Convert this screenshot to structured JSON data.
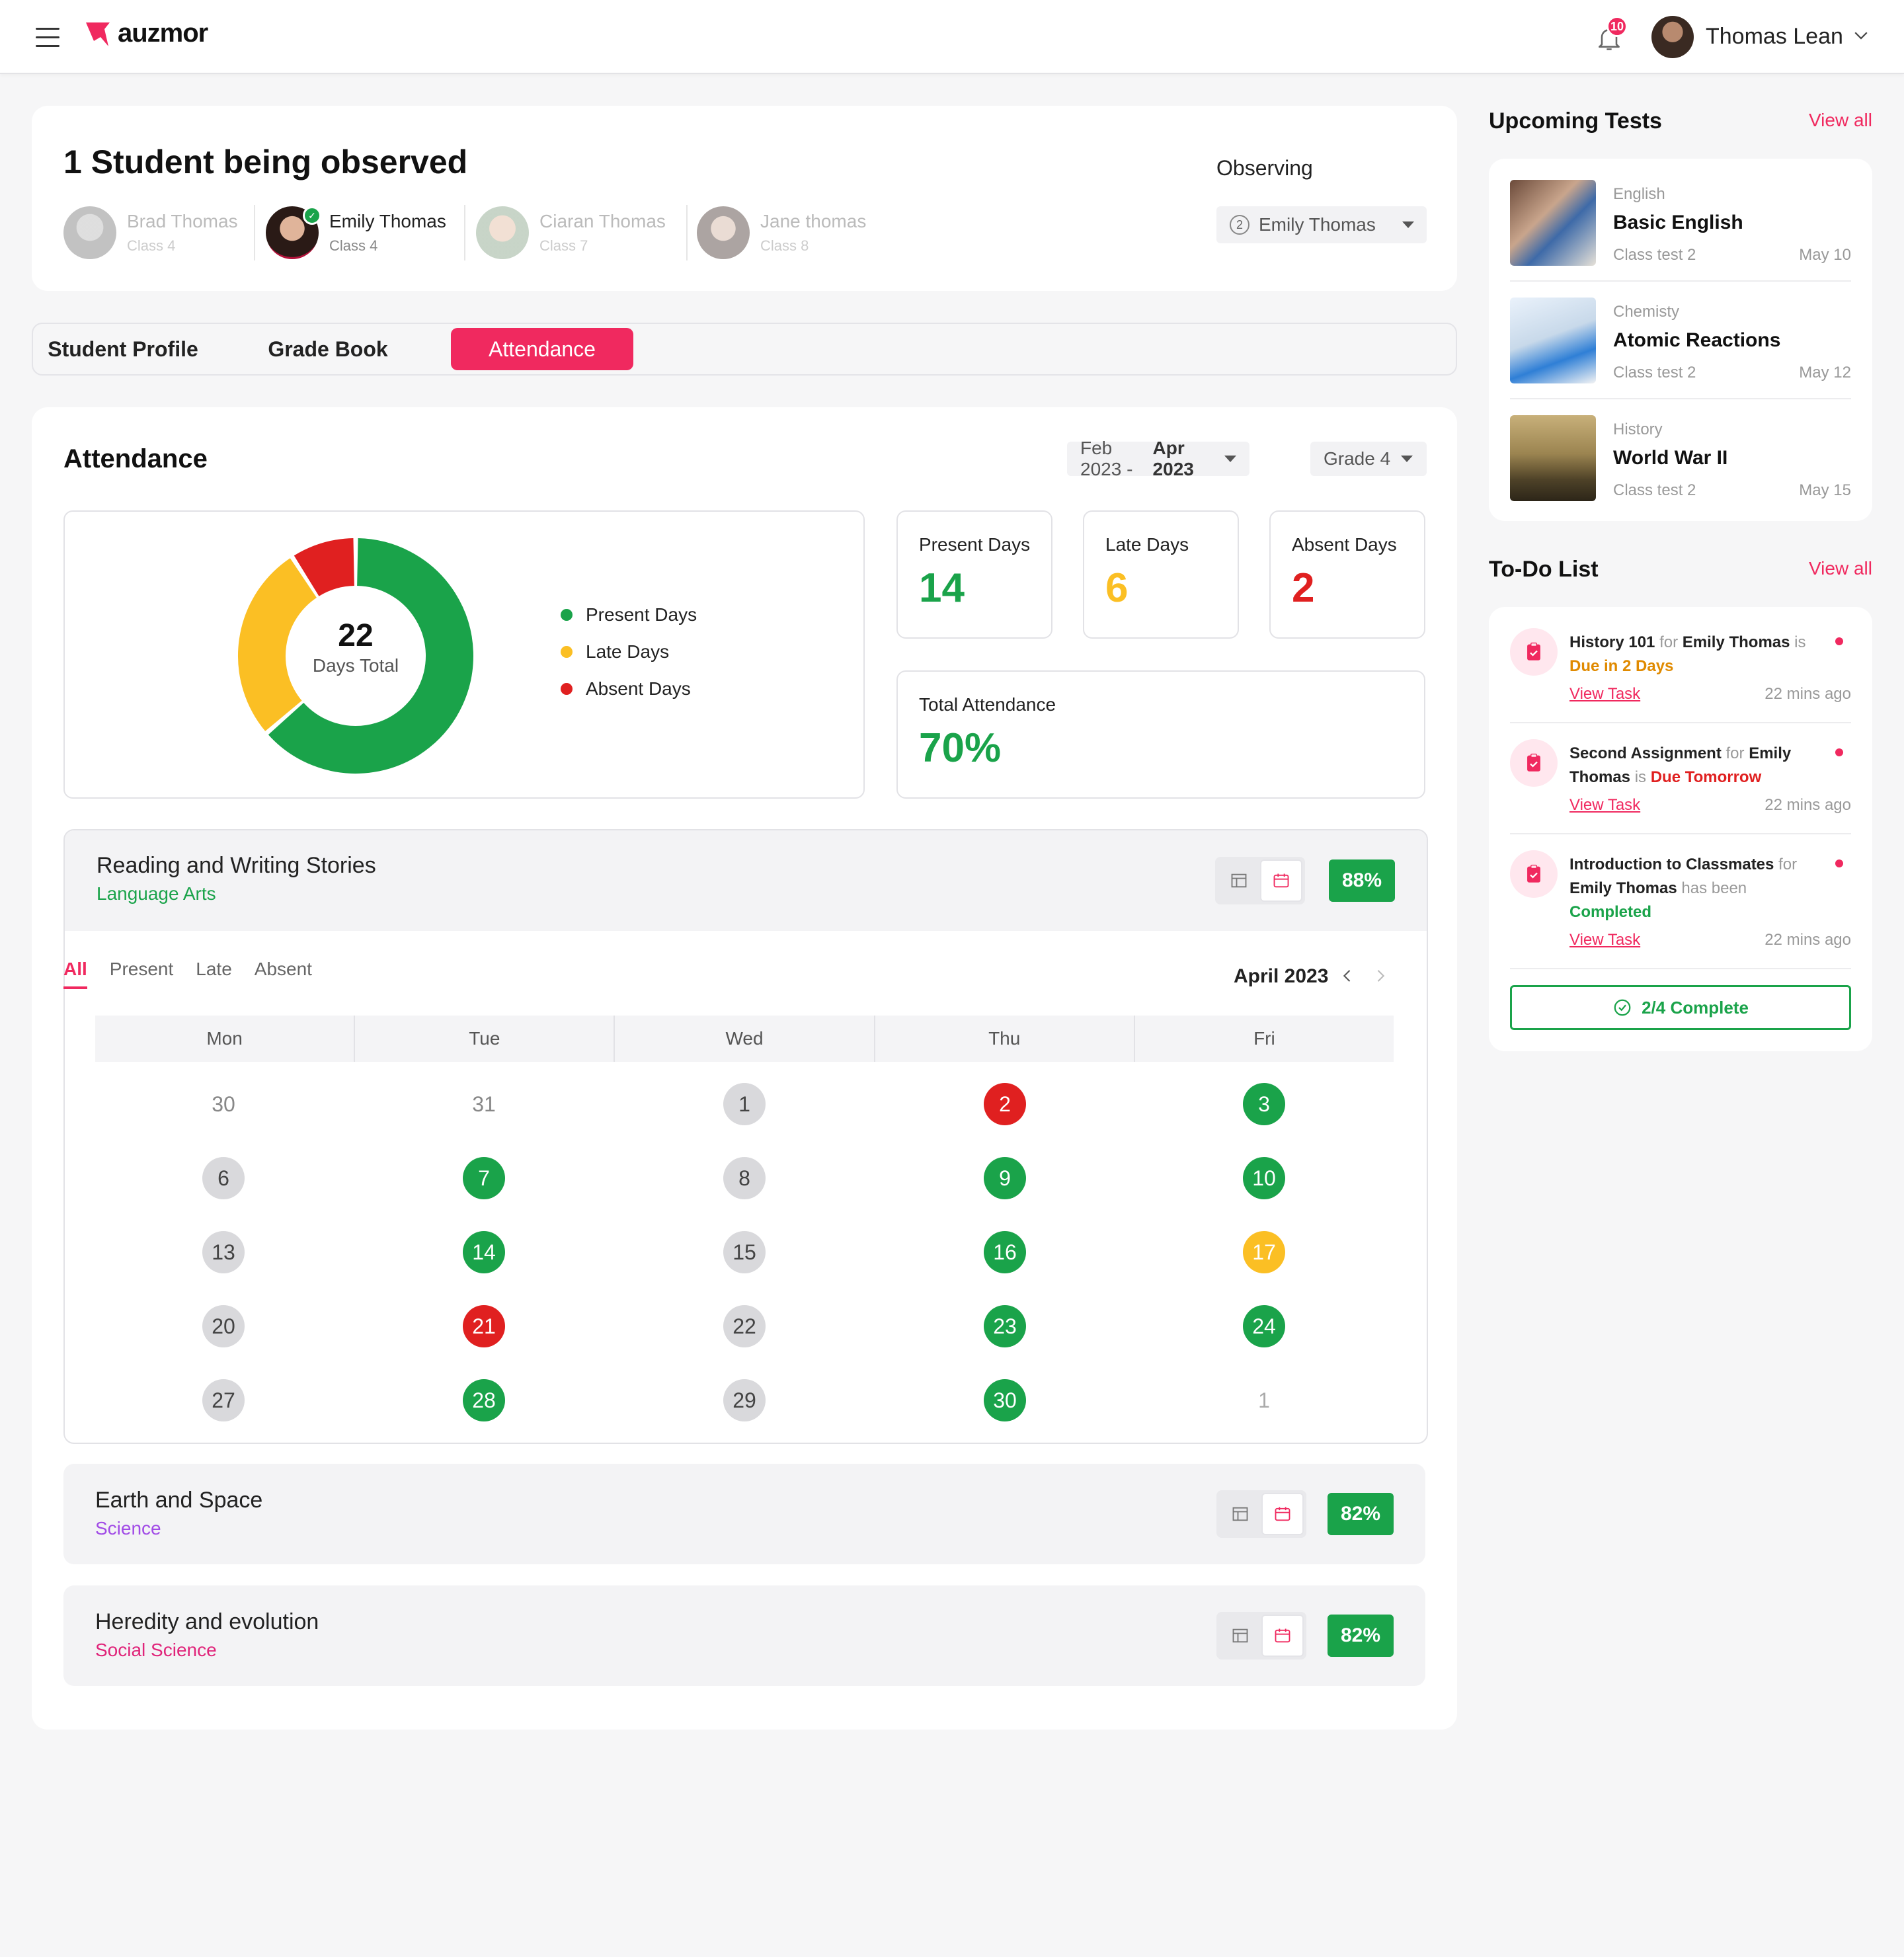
{
  "header": {
    "logo_text": "auzmor",
    "notification_count": "10",
    "user_name": "Thomas Lean"
  },
  "observed": {
    "title": "1 Student being observed",
    "students": [
      {
        "name": "Brad Thomas",
        "class": "Class 4"
      },
      {
        "name": "Emily Thomas",
        "class": "Class 4"
      },
      {
        "name": "Ciaran Thomas",
        "class": "Class 7"
      },
      {
        "name": "Jane thomas",
        "class": "Class 8"
      }
    ],
    "observing_label": "Observing",
    "observing_count": "2",
    "observing_value": "Emily Thomas"
  },
  "tabs": [
    "Student Profile",
    "Grade Book",
    "Attendance"
  ],
  "attendance": {
    "title": "Attendance",
    "range_from": "Feb 2023 - ",
    "range_to": "Apr 2023",
    "grade": "Grade 4",
    "donut_total": "22",
    "donut_caption": "Days Total",
    "legend": [
      "Present Days",
      "Late Days",
      "Absent Days"
    ],
    "stats": {
      "present_label": "Present Days",
      "present_value": "14",
      "late_label": "Late Days",
      "late_value": "6",
      "absent_label": "Absent Days",
      "absent_value": "2",
      "total_label": "Total Attendance",
      "total_value": "70%"
    },
    "donut": {
      "present": 14,
      "late": 6,
      "absent": 2
    }
  },
  "subjects": [
    {
      "title": "Reading and Writing Stories",
      "category": "Language Arts",
      "percent": "88%"
    },
    {
      "title": "Earth and Space",
      "category": "Science",
      "percent": "82%"
    },
    {
      "title": "Heredity and evolution",
      "category": "Social Science",
      "percent": "82%"
    }
  ],
  "calendar": {
    "filters": [
      "All",
      "Present",
      "Late",
      "Absent"
    ],
    "month": "April 2023",
    "weekdays": [
      "Mon",
      "Tue",
      "Wed",
      "Thu",
      "Fri"
    ],
    "weeks": [
      [
        {
          "d": "30",
          "s": "plain"
        },
        {
          "d": "31",
          "s": "plain"
        },
        {
          "d": "1",
          "s": "gray"
        },
        {
          "d": "2",
          "s": "red"
        },
        {
          "d": "3",
          "s": "green"
        }
      ],
      [
        {
          "d": "6",
          "s": "gray"
        },
        {
          "d": "7",
          "s": "green"
        },
        {
          "d": "8",
          "s": "gray"
        },
        {
          "d": "9",
          "s": "green"
        },
        {
          "d": "10",
          "s": "green"
        }
      ],
      [
        {
          "d": "13",
          "s": "gray"
        },
        {
          "d": "14",
          "s": "green"
        },
        {
          "d": "15",
          "s": "gray"
        },
        {
          "d": "16",
          "s": "green"
        },
        {
          "d": "17",
          "s": "yellow"
        }
      ],
      [
        {
          "d": "20",
          "s": "gray"
        },
        {
          "d": "21",
          "s": "red"
        },
        {
          "d": "22",
          "s": "gray"
        },
        {
          "d": "23",
          "s": "green"
        },
        {
          "d": "24",
          "s": "green"
        }
      ],
      [
        {
          "d": "27",
          "s": "gray"
        },
        {
          "d": "28",
          "s": "green"
        },
        {
          "d": "29",
          "s": "gray"
        },
        {
          "d": "30",
          "s": "green"
        },
        {
          "d": "1",
          "s": "plain muted"
        }
      ]
    ]
  },
  "upcoming": {
    "title": "Upcoming Tests",
    "view_all": "View all",
    "tests": [
      {
        "category": "English",
        "name": "Basic English",
        "test": "Class test 2",
        "date": "May 10"
      },
      {
        "category": "Chemisty",
        "name": "Atomic Reactions",
        "test": "Class test 2",
        "date": "May 12"
      },
      {
        "category": "History",
        "name": "World War II",
        "test": "Class test 2",
        "date": "May 15"
      }
    ]
  },
  "todo": {
    "title": "To-Do List",
    "view_all": "View all",
    "items": [
      {
        "task": "History 101",
        "for": "for",
        "student": "Emily Thomas",
        "is": "is",
        "status": "Due in 2 Days",
        "link": "View Task",
        "time": "22 mins ago"
      },
      {
        "task": "Second Assignment",
        "for": "for",
        "student": "Emily Thomas",
        "is": "is",
        "status": "Due Tomorrow",
        "link": "View Task",
        "time": "22 mins ago"
      },
      {
        "task": "Introduction to Classmates",
        "for": "for",
        "student": "Emily Thomas",
        "is": "has been",
        "status": "Completed",
        "link": "View Task",
        "time": "22 mins ago"
      }
    ],
    "complete": "2/4 Complete"
  },
  "colors": {
    "accent": "#f0295f",
    "present": "#1aa34a",
    "late": "#fbbf24",
    "absent": "#e02020"
  }
}
